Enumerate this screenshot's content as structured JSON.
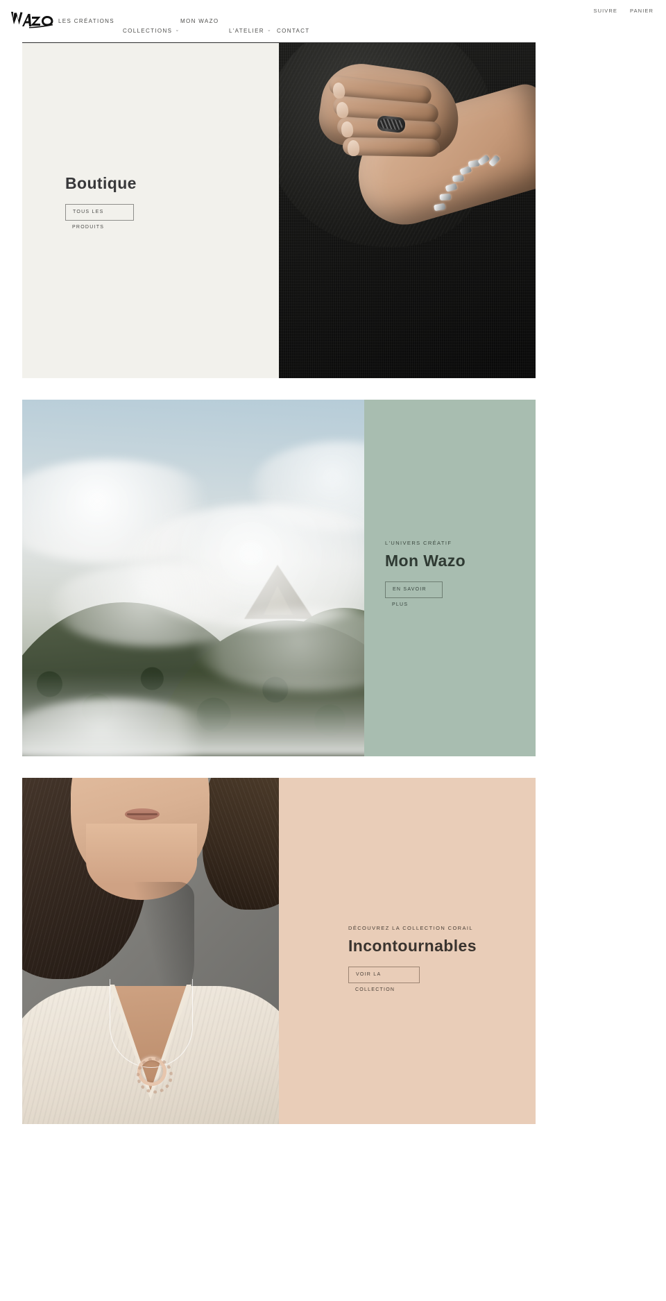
{
  "brand": {
    "name": "Wazo",
    "logo_icon": "wazo-wordmark-logo"
  },
  "header": {
    "utility_links": [
      {
        "label": "SUIVRE",
        "name": "suivre"
      },
      {
        "label": "PANIER",
        "name": "panier"
      }
    ],
    "nav": [
      {
        "label": "LES CRÉATIONS",
        "has_dropdown": false
      },
      {
        "label": "COLLECTIONS",
        "has_dropdown": true,
        "caret_icon": "chevron-down-icon"
      },
      {
        "label": "MON WAZO",
        "has_dropdown": false
      },
      {
        "label": "L'ATELIER",
        "has_dropdown": true,
        "caret_icon": "chevron-down-icon"
      },
      {
        "label": "CONTACT",
        "has_dropdown": false
      }
    ]
  },
  "sections": [
    {
      "id": "boutique",
      "eyebrow": "",
      "headline": "Boutique",
      "cta_line1": "TOUS LES",
      "cta_line2": "PRODUITS",
      "panel_color": "#f2f1ec",
      "image_side": "right",
      "image_alt": "main-with-ring-and-bracelet"
    },
    {
      "id": "mon-wazo",
      "eyebrow": "L'UNIVERS CRÉATIF",
      "headline": "Mon Wazo",
      "cta_line1": "EN SAVOIR",
      "cta_line2": "PLUS",
      "panel_color": "#a8bdb0",
      "image_side": "left",
      "image_alt": "montagne-dans-les-nuages"
    },
    {
      "id": "incontournables",
      "eyebrow": "DÉCOUVREZ LA COLLECTION CORAIL",
      "headline": "Incontournables",
      "cta_line1": "VOIR LA",
      "cta_line2": "COLLECTION",
      "panel_color": "#e9cdb8",
      "image_side": "left",
      "image_alt": "portrait-avec-collier-pendentif"
    }
  ],
  "colors": {
    "page_background": "#ffffff",
    "text_dark": "#3a3a38",
    "boutique_panel": "#f2f1ec",
    "sage_panel": "#a8bdb0",
    "peach_panel": "#e9cdb8",
    "rule": "#2b2b2b"
  }
}
